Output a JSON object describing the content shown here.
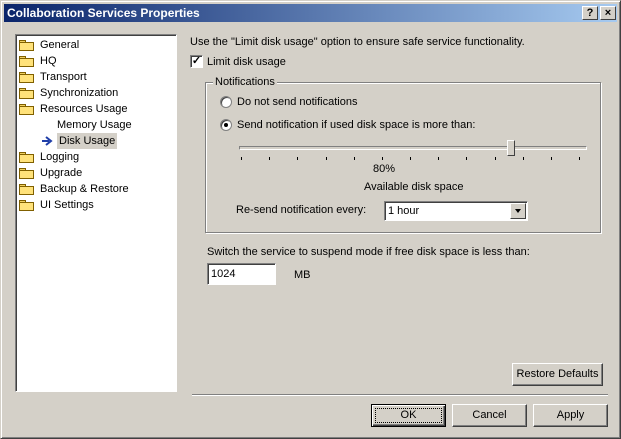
{
  "window": {
    "title": "Collaboration Services Properties",
    "help_label": "?",
    "close_label": "×"
  },
  "tree": {
    "items": [
      {
        "label": "General",
        "icon": "folder-icon"
      },
      {
        "label": "HQ",
        "icon": "folder-icon"
      },
      {
        "label": "Transport",
        "icon": "folder-icon"
      },
      {
        "label": "Synchronization",
        "icon": "folder-icon"
      },
      {
        "label": "Resources Usage",
        "icon": "folder-open-icon"
      },
      {
        "label": "Memory Usage",
        "icon": ""
      },
      {
        "label": "Disk Usage",
        "icon": "arrow-right-icon",
        "selected": true
      },
      {
        "label": "Logging",
        "icon": "folder-icon"
      },
      {
        "label": "Upgrade",
        "icon": "folder-icon"
      },
      {
        "label": "Backup & Restore",
        "icon": "folder-icon"
      },
      {
        "label": "UI Settings",
        "icon": "folder-icon"
      }
    ]
  },
  "main": {
    "description": "Use the \"Limit disk usage\" option to ensure safe service functionality.",
    "limit_checkbox": {
      "label": "Limit disk usage",
      "checked": true
    },
    "notifications": {
      "legend": "Notifications",
      "option_none": "Do not send notifications",
      "option_send": "Send notification if used disk space is more than:",
      "selected": "send",
      "slider_value_label": "80%",
      "slider_fraction": 0.8,
      "slider_caption": "Available disk space",
      "resend_label": "Re-send notification every:",
      "resend_value": "1 hour"
    },
    "suspend": {
      "label": "Switch the service to suspend mode if free disk space is less than:",
      "value": "1024",
      "unit": "MB"
    },
    "restore_defaults_label": "Restore Defaults"
  },
  "footer": {
    "ok_label": "OK",
    "cancel_label": "Cancel",
    "apply_label": "Apply"
  }
}
